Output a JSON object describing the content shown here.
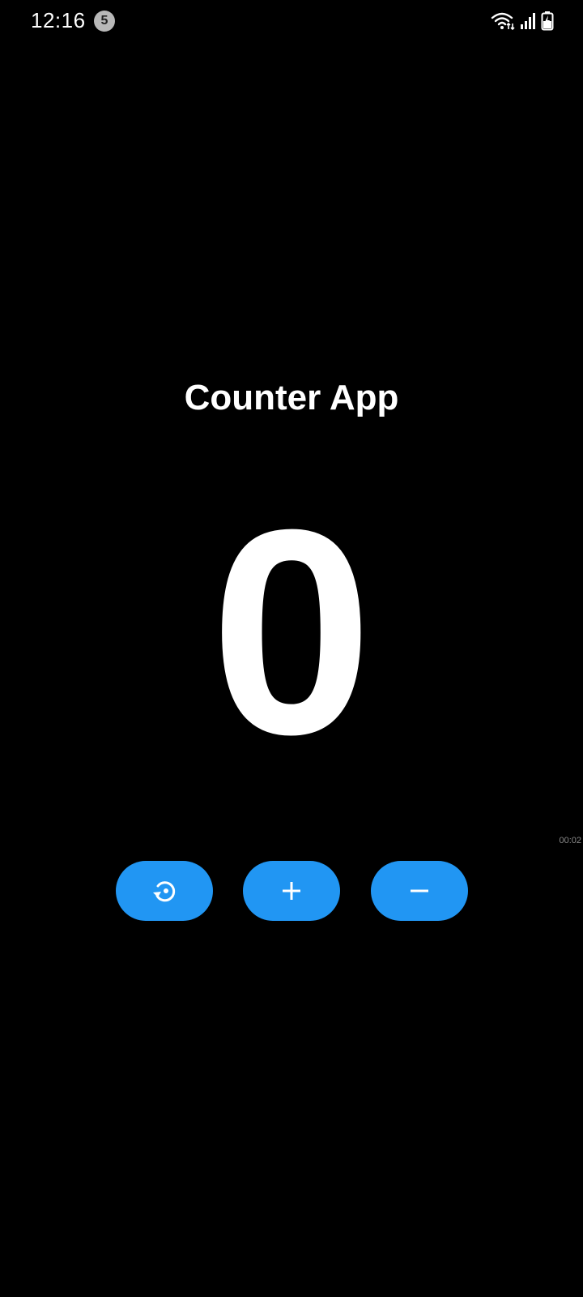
{
  "status_bar": {
    "time": "12:16",
    "notification_count": "5",
    "icons": [
      "wifi-icon",
      "signal-icon",
      "battery-charging-icon"
    ]
  },
  "app": {
    "title": "Counter App",
    "counter_value": "0",
    "timer": "00:02"
  },
  "buttons": [
    {
      "name": "reset-button",
      "icon": "reset-icon"
    },
    {
      "name": "increment-button",
      "icon": "plus-icon"
    },
    {
      "name": "decrement-button",
      "icon": "minus-icon"
    }
  ],
  "colors": {
    "background": "#000000",
    "button": "#2196f3",
    "text": "#ffffff"
  }
}
